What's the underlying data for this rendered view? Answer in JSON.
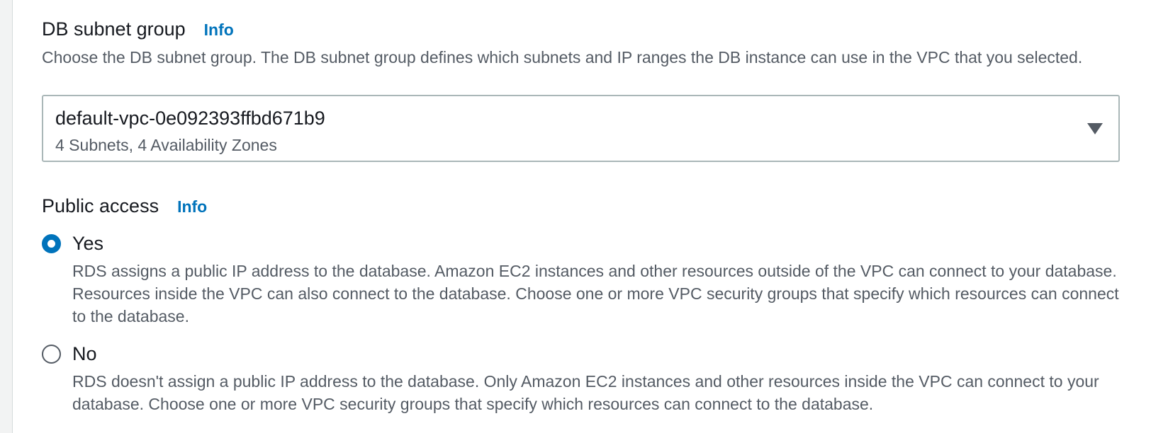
{
  "db_subnet_group": {
    "title": "DB subnet group",
    "info": "Info",
    "description": "Choose the DB subnet group. The DB subnet group defines which subnets and IP ranges the DB instance can use in the VPC that you selected.",
    "selected_value": "default-vpc-0e092393ffbd671b9",
    "selected_detail": "4 Subnets, 4 Availability Zones"
  },
  "public_access": {
    "title": "Public access",
    "info": "Info",
    "options": [
      {
        "label": "Yes",
        "checked": true,
        "description": "RDS assigns a public IP address to the database. Amazon EC2 instances and other resources outside of the VPC can connect to your database. Resources inside the VPC can also connect to the database. Choose one or more VPC security groups that specify which resources can connect to the database."
      },
      {
        "label": "No",
        "checked": false,
        "description": "RDS doesn't assign a public IP address to the database. Only Amazon EC2 instances and other resources inside the VPC can connect to your database. Choose one or more VPC security groups that specify which resources can connect to the database."
      }
    ]
  },
  "colors": {
    "accent": "#0073bb",
    "text_primary": "#16191f",
    "text_secondary": "#545b64",
    "border": "#aab7b8"
  },
  "icons": {
    "select_caret": "caret-down-icon"
  }
}
